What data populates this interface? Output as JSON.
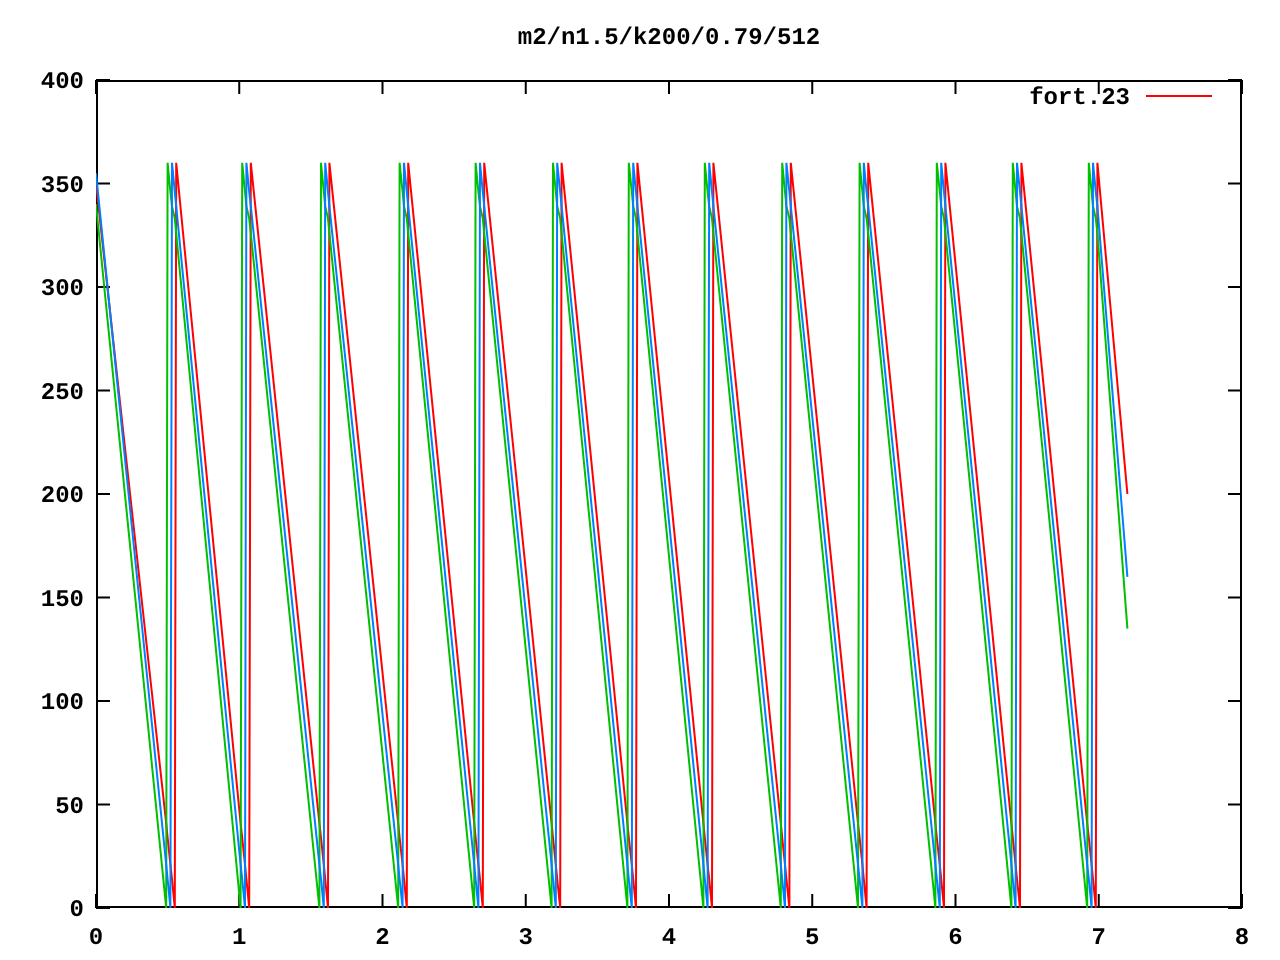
{
  "chart": {
    "chart_data": {
      "type": "line",
      "title": "m2/n1.5/k200/0.79/512",
      "x": [
        0,
        0.49,
        0.5,
        0.52,
        0.53,
        0.55,
        0.56,
        1.01,
        1.02,
        1.04,
        1.05,
        1.07,
        1.08,
        1.56,
        1.57,
        1.59,
        1.6,
        1.62,
        1.63,
        2.11,
        2.12,
        2.14,
        2.15,
        2.17,
        2.18,
        2.64,
        2.65,
        2.67,
        2.68,
        2.7,
        2.71,
        3.18,
        3.19,
        3.21,
        3.22,
        3.24,
        3.25,
        3.71,
        3.72,
        3.74,
        3.75,
        3.77,
        3.78,
        4.24,
        4.25,
        4.27,
        4.28,
        4.3,
        4.31,
        4.78,
        4.79,
        4.81,
        4.82,
        4.84,
        4.85,
        5.32,
        5.33,
        5.35,
        5.36,
        5.38,
        5.39,
        5.86,
        5.87,
        5.89,
        5.9,
        5.92,
        5.93,
        6.39,
        6.4,
        6.42,
        6.43,
        6.45,
        6.46,
        6.92,
        6.93,
        6.95,
        6.96,
        6.98,
        6.99,
        7.2
      ],
      "series": [
        {
          "name": "fort.23",
          "color": "#ff0000",
          "values": [
            350,
            41,
            34,
            21,
            14,
            0,
            360,
            41,
            34,
            21,
            14,
            0,
            360,
            41,
            34,
            21,
            14,
            0,
            360,
            41,
            34,
            21,
            14,
            0,
            360,
            41,
            34,
            21,
            14,
            0,
            360,
            41,
            34,
            21,
            14,
            0,
            360,
            41,
            34,
            21,
            14,
            0,
            360,
            41,
            34,
            21,
            14,
            0,
            360,
            41,
            34,
            21,
            14,
            0,
            360,
            41,
            34,
            21,
            14,
            0,
            360,
            41,
            34,
            21,
            14,
            0,
            360,
            41,
            34,
            21,
            14,
            0,
            360,
            41,
            34,
            21,
            14,
            0,
            360,
            200
          ]
        },
        {
          "color": "#00c000",
          "values": [
            340,
            0,
            360,
            346,
            339,
            333,
            326,
            0,
            360,
            346,
            339,
            333,
            326,
            0,
            360,
            346,
            339,
            333,
            326,
            0,
            360,
            346,
            339,
            333,
            326,
            0,
            360,
            346,
            339,
            333,
            326,
            0,
            360,
            346,
            339,
            333,
            326,
            0,
            360,
            346,
            339,
            333,
            326,
            0,
            360,
            346,
            339,
            333,
            326,
            0,
            360,
            346,
            339,
            333,
            326,
            0,
            360,
            346,
            339,
            333,
            326,
            0,
            360,
            346,
            339,
            333,
            326,
            0,
            360,
            346,
            339,
            333,
            326,
            0,
            360,
            346,
            339,
            333,
            326,
            135
          ]
        },
        {
          "color": "#0080ff",
          "values": [
            355,
            21,
            14,
            0,
            360,
            346,
            339,
            21,
            14,
            0,
            360,
            346,
            339,
            21,
            14,
            0,
            360,
            346,
            339,
            21,
            14,
            0,
            360,
            346,
            339,
            21,
            14,
            0,
            360,
            346,
            339,
            21,
            14,
            0,
            360,
            346,
            339,
            21,
            14,
            0,
            360,
            346,
            339,
            21,
            14,
            0,
            360,
            346,
            339,
            21,
            14,
            0,
            360,
            346,
            339,
            21,
            14,
            0,
            360,
            346,
            339,
            21,
            14,
            0,
            360,
            346,
            339,
            21,
            14,
            0,
            360,
            346,
            339,
            21,
            14,
            0,
            360,
            346,
            339,
            160
          ]
        }
      ],
      "xlim": [
        0,
        8
      ],
      "ylim": [
        0,
        400
      ],
      "xticks": [
        0,
        1,
        2,
        3,
        4,
        5,
        6,
        7,
        8
      ],
      "yticks": [
        0,
        50,
        100,
        150,
        200,
        250,
        300,
        350,
        400
      ]
    }
  }
}
